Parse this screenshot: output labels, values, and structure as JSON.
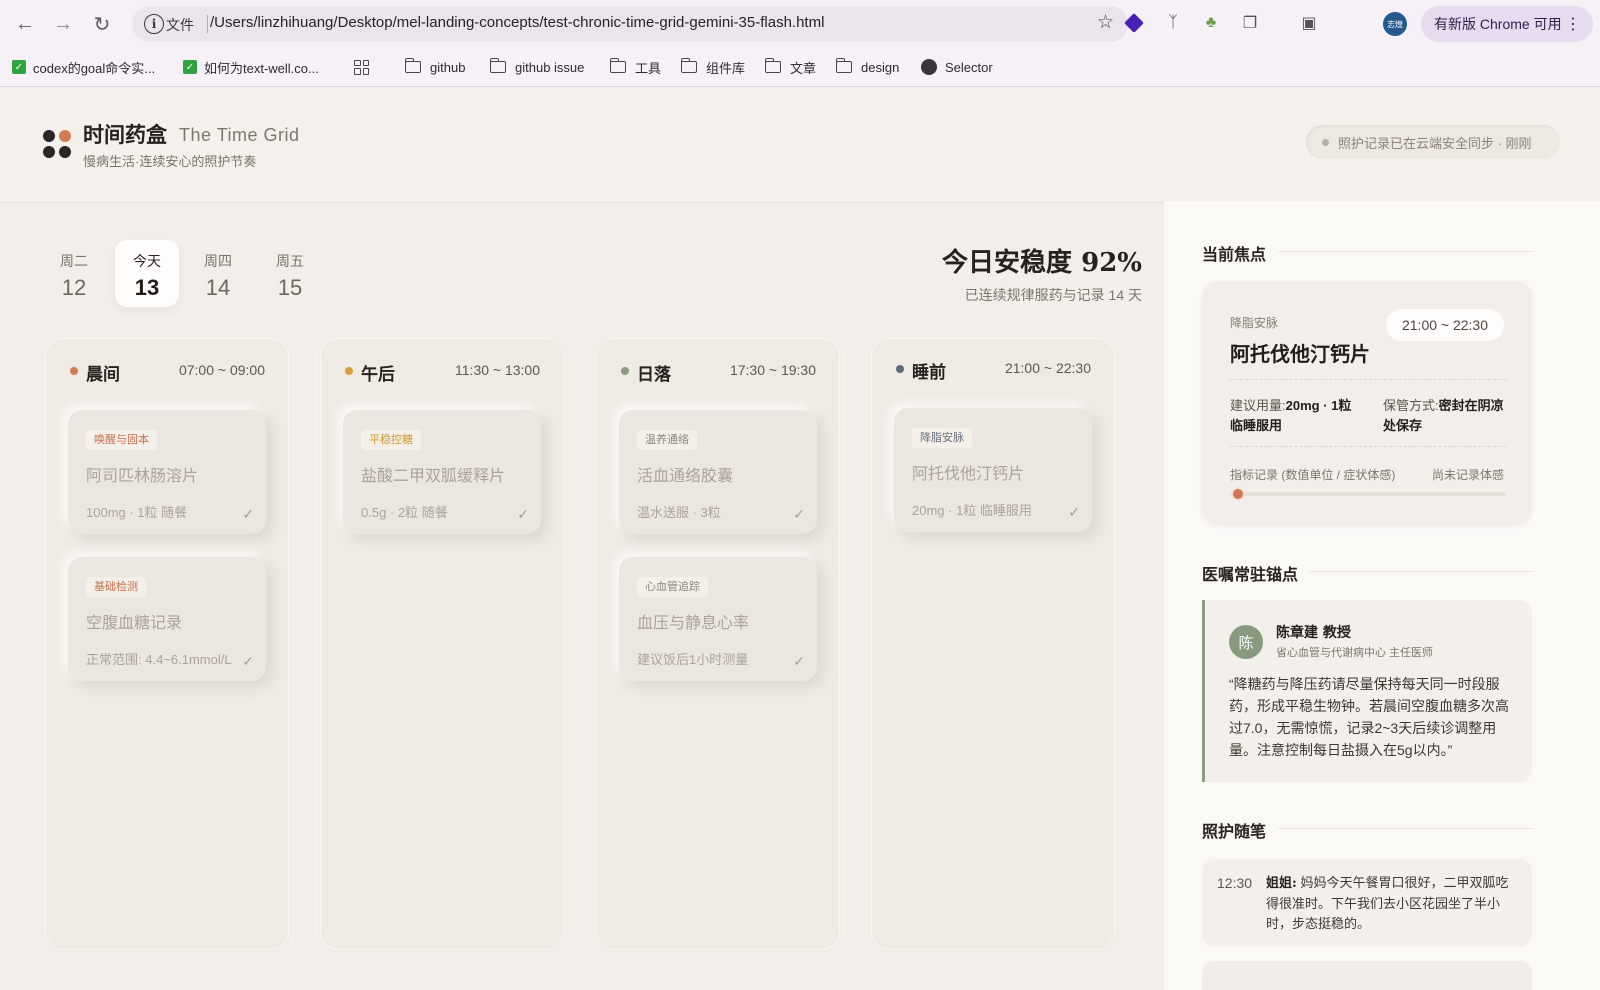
{
  "browser": {
    "omnibox": {
      "scheme_label": "文件",
      "url": "/Users/linzhihuang/Desktop/mel-landing-concepts/test-chronic-time-grid-gemini-35-flash.html"
    },
    "avatar_label": "志煌",
    "update_label": "有新版 Chrome 可用",
    "bookmarks": [
      {
        "label": "codex的goal命令实...",
        "icon": "check-icon"
      },
      {
        "label": "如何为text-well.co...",
        "icon": "check-icon"
      },
      {
        "label": "github",
        "icon": "folder-icon"
      },
      {
        "label": "github issue",
        "icon": "folder-icon"
      },
      {
        "label": "工具",
        "icon": "folder-icon"
      },
      {
        "label": "组件库",
        "icon": "folder-icon"
      },
      {
        "label": "文章",
        "icon": "folder-icon"
      },
      {
        "label": "design",
        "icon": "folder-icon"
      },
      {
        "label": "Selector",
        "icon": "globe-icon"
      }
    ]
  },
  "header": {
    "title": "时间药盒",
    "subtitle": "The Time Grid",
    "tagline": "慢病生活·连续安心的照护节奏",
    "sync_status": "照护记录已在云端安全同步 · 刚刚"
  },
  "days": [
    {
      "label": "周二",
      "num": "12",
      "active": false
    },
    {
      "label": "今天",
      "num": "13",
      "active": true
    },
    {
      "label": "周四",
      "num": "14",
      "active": false
    },
    {
      "label": "周五",
      "num": "15",
      "active": false
    }
  ],
  "summary": {
    "stability": "今日安稳度 92%",
    "streak": "已连续规律服药与记录 14 天"
  },
  "columns": [
    {
      "name": "晨间",
      "time": "07:00 ~ 09:00",
      "dot_color": "#d07a56",
      "cards": [
        {
          "tag": "唤醒与固本",
          "tag_color": "#c9714c",
          "title": "阿司匹林肠溶片",
          "meta": "100mg · 1粒 随餐"
        },
        {
          "tag": "基础检测",
          "tag_color": "#c9714c",
          "title": "空腹血糖记录",
          "meta": "正常范围: 4.4~6.1mmol/L"
        }
      ]
    },
    {
      "name": "午后",
      "time": "11:30 ~ 13:00",
      "dot_color": "#d8a03c",
      "cards": [
        {
          "tag": "平稳控糖",
          "tag_color": "#d39a36",
          "title": "盐酸二甲双胍缓释片",
          "meta": "0.5g · 2粒 随餐"
        }
      ]
    },
    {
      "name": "日落",
      "time": "17:30 ~ 19:30",
      "dot_color": "#8a9b80",
      "cards": [
        {
          "tag": "温养通络",
          "tag_color": "#8c8880",
          "title": "活血通络胶囊",
          "meta": "温水送服 · 3粒"
        },
        {
          "tag": "心血管追踪",
          "tag_color": "#8c8880",
          "title": "血压与静息心率",
          "meta": "建议饭后1小时测量"
        }
      ]
    },
    {
      "name": "睡前",
      "time": "21:00 ~ 22:30",
      "dot_color": "#5d6a7a",
      "cards": [
        {
          "tag": "降脂安脉",
          "tag_color": "#6a7380",
          "title": "阿托伐他汀钙片",
          "meta": "20mg · 1粒 临睡服用"
        }
      ]
    }
  ],
  "side": {
    "focus_title": "当前焦点",
    "focus": {
      "tag": "降脂安脉",
      "name": "阿托伐他汀钙片",
      "time": "21:00 ~ 22:30",
      "dose_label": "建议用量:",
      "dose_value": "20mg · 1粒 临睡服用",
      "storage_label": "保管方式:",
      "storage_value": "密封在阴凉处保存",
      "record_label": "指标记录 (数值单位 / 症状体感)",
      "record_status": "尚未记录体感",
      "slider_value": 0
    },
    "doctor_title": "医嘱常驻锚点",
    "doctor": {
      "avatar": "陈",
      "name": "陈章建 教授",
      "title": "省心血管与代谢病中心 主任医师",
      "quote": "“降糖药与降压药请尽量保持每天同一时段服药，形成平稳生物钟。若晨间空腹血糖多次高过7.0，无需惊慌，记录2~3天后续诊调整用量。注意控制每日盐摄入在5g以内。”"
    },
    "notes_title": "照护随笔",
    "note": {
      "time": "12:30",
      "author": "姐姐:",
      "text": "妈妈今天午餐胃口很好，二甲双胍吃得很准时。下午我们去小区花园坐了半小时，步态挺稳的。"
    }
  }
}
